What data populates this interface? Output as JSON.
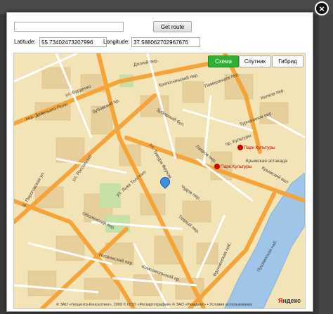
{
  "route": {
    "input_value": "",
    "button_label": "Get route"
  },
  "coords": {
    "latitude_label": "Latitude:",
    "latitude_value": "55.73402473207996",
    "longitude_label": "Longitude:",
    "longitude_value": "37.588062702967676"
  },
  "close_label": "×",
  "map_types": [
    {
      "label": "Схема",
      "active": true
    },
    {
      "label": "Спутник",
      "active": false
    },
    {
      "label": "Гибрид",
      "active": false
    }
  ],
  "streets": {
    "burdenko": "ул. Бурденко",
    "devichy": "пер. Девичьего Поля",
    "zubovsky_pr": "Зубовский пр.",
    "zubovsky_bul": "Зубовский бул.",
    "rossolimo": "ул. Россолимо",
    "lva_tolstogo": "ул. Льва Толстого",
    "timura": "ул. Тимура Фрунзе",
    "chudov": "Чудов пер.",
    "obolensky": "Оболенский пер.",
    "nesvizhsky": "Несвижский пер.",
    "komsomolsky": "Комсомольский пр.",
    "frunzenskaya": "Фрунзенская наб.",
    "pushkinskaya": "Пушкинская наб.",
    "krymsky_val": "Крымский вал",
    "krymskaya_est": "Крымская эстакада",
    "pogodinskaya": "Б. Пироговская ул.",
    "turchaninov": "Турчанинов пер.",
    "pomerantsev": "Померанцев пер.",
    "khilkov": "Хилков пер.",
    "kropotkinsky": "Кропоткинский пер.",
    "dolgy": "Долгий пер.",
    "kultury": "пр. Культуры",
    "lavrov": "Лавров пер.",
    "teply": "Теплый пер.",
    "lva_tolstogo2": "ул. Льва Толстого"
  },
  "metro": {
    "park_kultury_1": "Парк Культуры",
    "park_kultury_2": "Парк Культуры"
  },
  "copyright": "© ЗАО «Геоцентр-Консалтинг», 2009  © ООО «Роскартография»  © ЗАО «Резидент» • Условия использования",
  "brand": {
    "prefix": "Я",
    "rest": "ндекс"
  }
}
